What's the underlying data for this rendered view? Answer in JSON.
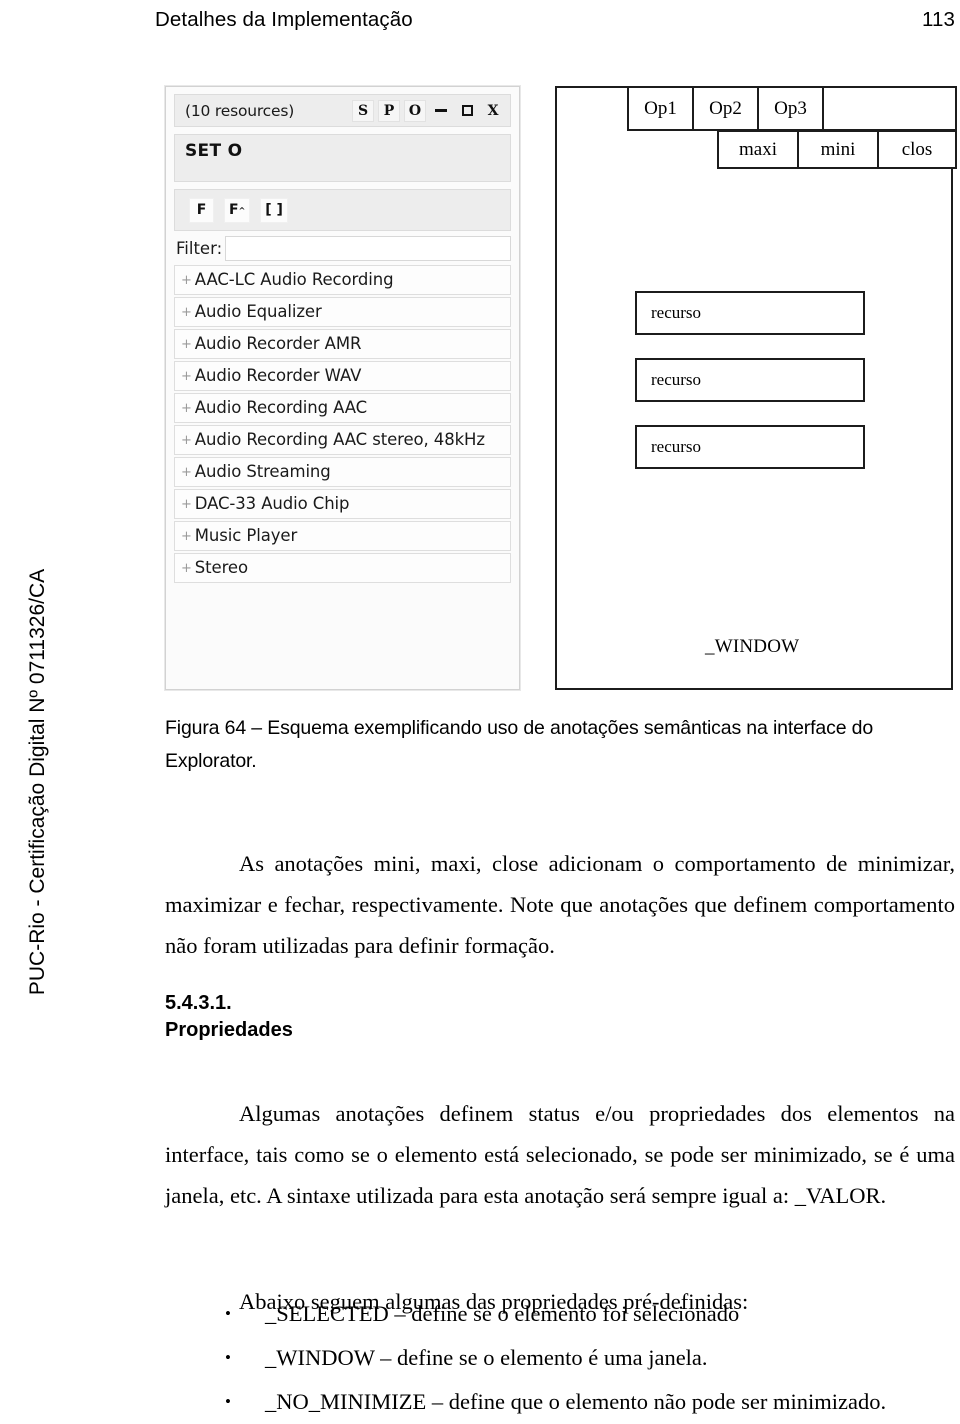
{
  "header": {
    "chapter_title": "Detalhes da Implementação",
    "page_number": "113"
  },
  "side_stamp": "PUC-Rio - Certificação Digital Nº 0711326/CA",
  "figure": {
    "app": {
      "resource_count_label": "(10 resources)",
      "window_buttons": [
        {
          "name": "s-button",
          "label": "S"
        },
        {
          "name": "p-button",
          "label": "P"
        },
        {
          "name": "o-button",
          "label": "O"
        },
        {
          "name": "minimize-button",
          "label": ""
        },
        {
          "name": "maximize-button",
          "label": ""
        },
        {
          "name": "close-button",
          "label": "X"
        }
      ],
      "set_label": "SET O",
      "mode_buttons": [
        {
          "name": "f-button",
          "label": "F",
          "sup": ""
        },
        {
          "name": "f-sup-button",
          "label": "F",
          "sup": "^"
        },
        {
          "name": "brackets-button",
          "label": "[ ]",
          "sup": ""
        }
      ],
      "filter_label": "Filter:",
      "filter_value": "",
      "filter_placeholder": "",
      "resources": [
        "AAC-LC Audio Recording",
        "Audio Equalizer",
        "Audio Recorder AMR",
        "Audio Recorder WAV",
        "Audio Recording AAC",
        "Audio Recording AAC stereo, 48kHz",
        "Audio Streaming",
        "DAC-33 Audio Chip",
        "Music Player",
        "Stereo"
      ],
      "expand_glyph": "+"
    },
    "schema": {
      "option_tabs": [
        "Op1",
        "Op2",
        "Op3"
      ],
      "window_annotations": [
        "maxi",
        "mini",
        "clos"
      ],
      "resource_boxes": [
        "recurso",
        "recurso",
        "recurso"
      ],
      "window_property": "_WINDOW"
    }
  },
  "caption": "Figura 64 – Esquema exemplificando uso de anotações semânticas na interface do Explorator.",
  "paragraphs": {
    "annotations": "As anotações mini, maxi, close adicionam o comportamento de minimizar, maximizar e fechar, respectivamente. Note que anotações que definem comportamento não foram utilizadas para definir formação.",
    "properties": "Algumas anotações definem status e/ou propriedades dos elementos na interface, tais como se o elemento está selecionado, se pode ser minimizado, se é uma janela, etc. A sintaxe utilizada para esta anotação será sempre igual a: _VALOR.",
    "below_intro": "Abaixo seguem algumas das propriedades pré-definidas:"
  },
  "section": {
    "number": "5.4.3.1.",
    "title": "Propriedades"
  },
  "bullet_list": [
    "_SELECTED – define se o elemento foi selecionado",
    "_WINDOW – define se o elemento é uma janela.",
    "_NO_MINIMIZE – define que o elemento não pode ser minimizado."
  ],
  "bullet_glyph": "•",
  "colors": {
    "text": "#000000",
    "schema_border": "#1c1c1c",
    "panel_bg": "#ededed",
    "panel_border": "#dcdcdc"
  }
}
